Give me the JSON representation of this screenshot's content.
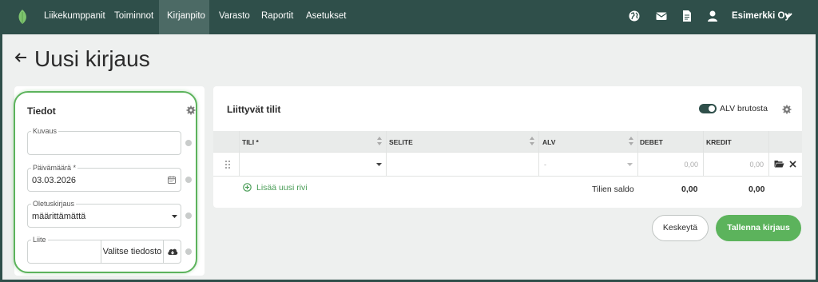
{
  "nav": {
    "items": [
      {
        "label": "Liikekumppanit",
        "active": false
      },
      {
        "label": "Toiminnot",
        "active": false
      },
      {
        "label": "Kirjanpito",
        "active": true
      },
      {
        "label": "Varasto",
        "active": false
      },
      {
        "label": "Raportit",
        "active": false
      },
      {
        "label": "Asetukset",
        "active": false
      }
    ],
    "icons": [
      "globe-icon",
      "mail-icon",
      "document-icon",
      "user-icon"
    ],
    "company": "Esimerkki Oy"
  },
  "page": {
    "title": "Uusi kirjaus"
  },
  "details": {
    "title": "Tiedot",
    "fields": {
      "description": {
        "label": "Kuvaus",
        "value": ""
      },
      "date": {
        "label": "Päivämäärä *",
        "value": "03.03.2026"
      },
      "default_entry": {
        "label": "Oletuskirjaus",
        "value": "määrittämättä"
      },
      "attachment": {
        "label": "Liite",
        "value": "",
        "button": "Valitse tiedosto"
      }
    }
  },
  "accounts": {
    "title": "Liittyvät tilit",
    "toggle": {
      "label": "ALV brutosta",
      "on": true
    },
    "columns": {
      "account": "TILI *",
      "description": "SELITE",
      "vat": "ALV",
      "debit": "DEBET",
      "credit": "KREDIT"
    },
    "row": {
      "account": "",
      "description": "",
      "vat": "-",
      "debit": "0,00",
      "credit": "0,00"
    },
    "add_row": "Lisää uusi rivi",
    "balance_label": "Tilien saldo",
    "balance_debit": "0,00",
    "balance_credit": "0,00"
  },
  "actions": {
    "cancel": "Keskeytä",
    "save": "Tallenna kirjaus"
  },
  "colors": {
    "navbar": "#2f4f4a",
    "active_nav": "#4c6a65",
    "accent_green": "#5cb35c",
    "background": "#eef0ef"
  }
}
